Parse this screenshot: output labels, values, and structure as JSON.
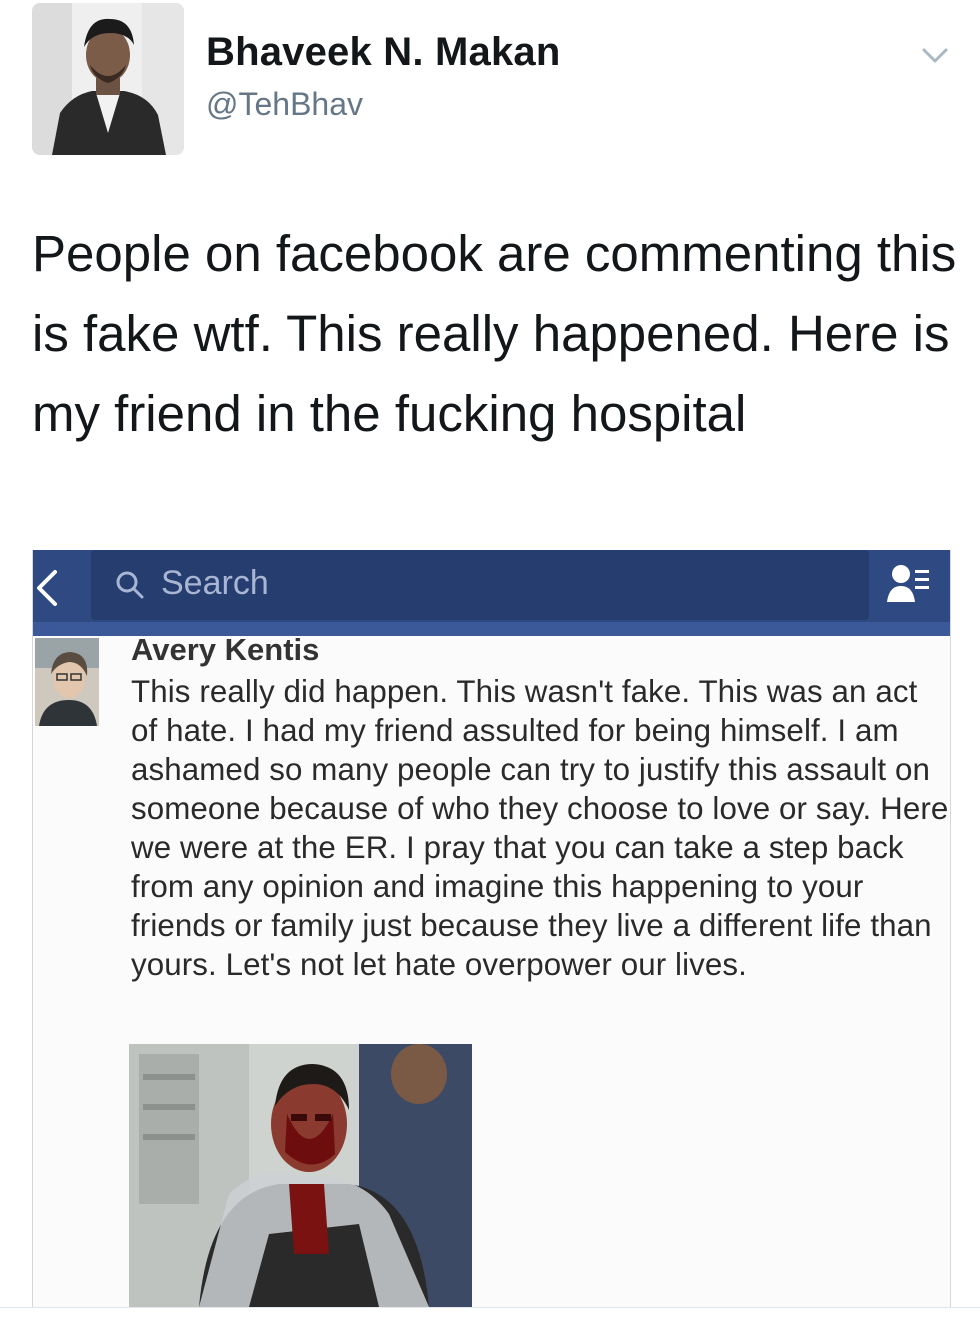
{
  "tweet": {
    "author_name": "Bhaveek N. Makan",
    "handle": "@TehBhav",
    "text": "People on facebook are commenting this is fake wtf. This really happened. Here is my friend in the fucking hospital",
    "avatar_icon": "profile-photo",
    "menu_icon": "chevron-down-icon"
  },
  "facebook_screenshot": {
    "search_placeholder": "Search",
    "back_icon": "chevron-left-icon",
    "search_icon": "search-icon",
    "friends_icon": "friend-requests-icon",
    "comment_author": "Avery Kentis",
    "comment_text": "This really did happen. This wasn't fake. This was an act of hate. I had my friend assulted for being himself. I am ashamed so many people can try to justify this assault on someone because of who they choose to love or say. Here we were at the ER. I pray that you can take a step back from any opinion and imagine this happening to your friends or family just because they live a different life than yours. Let's not let hate overpower our lives.",
    "bar_color": "#3b5998"
  }
}
